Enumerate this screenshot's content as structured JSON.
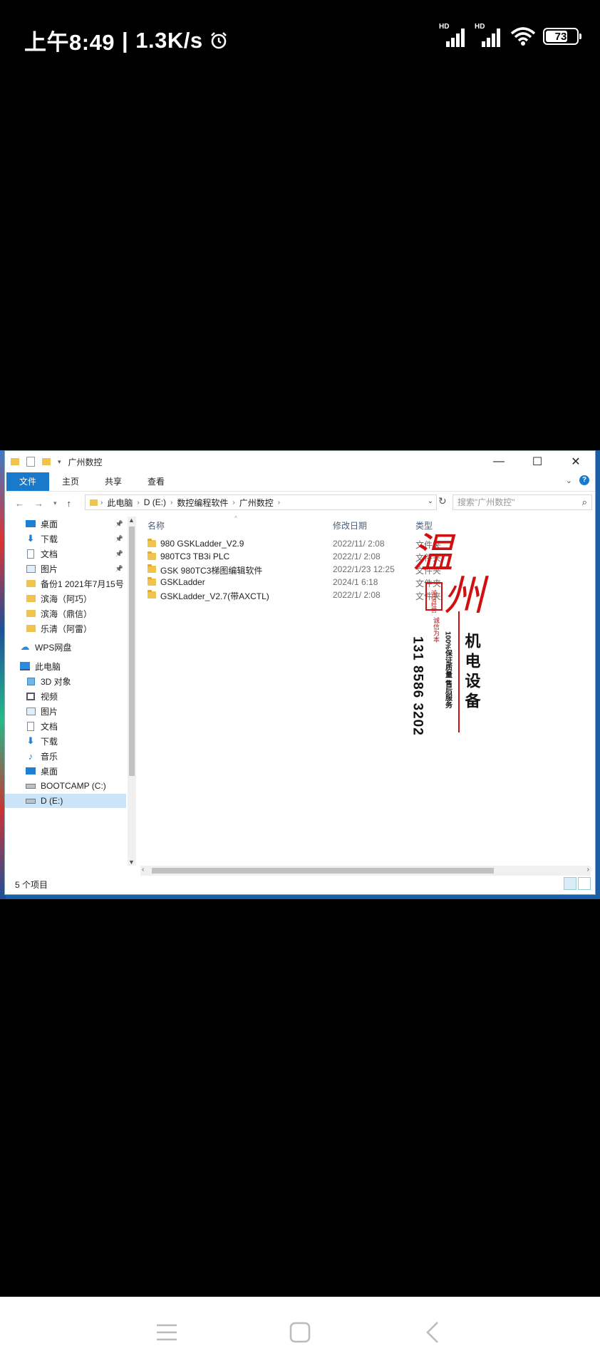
{
  "status_bar": {
    "time": "上午8:49",
    "separator": "|",
    "net_speed": "1.3K/s",
    "sim1_label": "HD",
    "sim2_label": "HD",
    "battery": "73",
    "battery_level": 0.73
  },
  "explorer": {
    "title": "广州数控",
    "ribbon_tabs": [
      "文件",
      "主页",
      "共享",
      "查看"
    ],
    "address": {
      "crumbs": [
        "此电脑",
        "D (E:)",
        "数控编程软件",
        "广州数控"
      ]
    },
    "search_placeholder": "搜索\"广州数控\"",
    "sidebar": [
      {
        "label": "桌面",
        "icon": "desktop-icon",
        "pinned": true
      },
      {
        "label": "下载",
        "icon": "download-icon",
        "pinned": true
      },
      {
        "label": "文档",
        "icon": "document-icon",
        "pinned": true
      },
      {
        "label": "图片",
        "icon": "picture-icon",
        "pinned": true
      },
      {
        "label": "备份1 2021年7月15号",
        "icon": "folder-icon",
        "pinned": false
      },
      {
        "label": "滨海（阿巧）",
        "icon": "folder-icon",
        "pinned": false
      },
      {
        "label": "滨海（鼎信）",
        "icon": "folder-icon",
        "pinned": false
      },
      {
        "label": "乐清（阿雷）",
        "icon": "folder-icon",
        "pinned": false
      },
      {
        "label": "WPS网盘",
        "icon": "cloud-icon",
        "pinned": false
      },
      {
        "label": "此电脑",
        "icon": "computer-icon",
        "pinned": false
      },
      {
        "label": "3D 对象",
        "icon": "cube-icon",
        "pinned": false
      },
      {
        "label": "视频",
        "icon": "video-icon",
        "pinned": false
      },
      {
        "label": "图片",
        "icon": "picture-icon",
        "pinned": false
      },
      {
        "label": "文档",
        "icon": "document-icon",
        "pinned": false
      },
      {
        "label": "下载",
        "icon": "download-icon",
        "pinned": false
      },
      {
        "label": "音乐",
        "icon": "music-icon",
        "pinned": false
      },
      {
        "label": "桌面",
        "icon": "desktop-icon",
        "pinned": false
      },
      {
        "label": "BOOTCAMP (C:)",
        "icon": "drive-icon",
        "pinned": false
      },
      {
        "label": "D (E:)",
        "icon": "drive-icon",
        "pinned": false
      }
    ],
    "columns": {
      "name": "名称",
      "date": "修改日期",
      "type": "类型"
    },
    "files": [
      {
        "name": "980 GSKLadder_V2.9",
        "date": "2022/11/    2:08",
        "type": "文件夹"
      },
      {
        "name": "980TC3 TB3i PLC",
        "date": "2022/1/    2:08",
        "type": "文件夹"
      },
      {
        "name": "GSK 980TC3梯图编辑软件",
        "date": "2022/1/23 12:25",
        "type": "文件夹"
      },
      {
        "name": "GSKLadder",
        "date": "2024/1    6:18",
        "type": "文件夹"
      },
      {
        "name": "GSKLadder_V2.7(带AXCTL)",
        "date": "2022/1/    2:08",
        "type": "文件夹"
      }
    ],
    "item_count": "5 个项目"
  },
  "watermark": {
    "big_char_1": "温",
    "big_char_2": "州",
    "line1": "机电设备",
    "phone": "131 8586 3202",
    "slogan1": "诚信为本",
    "slogan2": "100%保证质量 售后服务",
    "stamp": "诚信经营"
  },
  "colors": {
    "accent": "#1979ca",
    "folder": "#f0c34d",
    "selected": "#cce4f7",
    "watermark_red": "#d01010"
  }
}
